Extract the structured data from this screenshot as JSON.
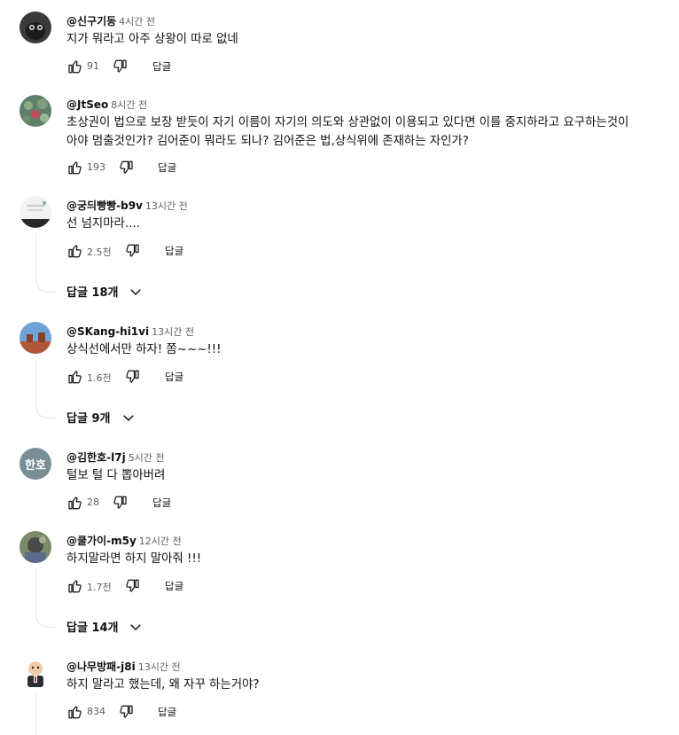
{
  "comments": [
    {
      "author": "@신구기동",
      "time": "4시간 전",
      "text": "지가 뭐라고 아주 상왕이 따로 없네",
      "text2": "",
      "likes": "91",
      "reply_label": "답글",
      "replies_toggle": ""
    },
    {
      "author": "@JtSeo",
      "time": "8시간 전",
      "text": "초상권이 법으로 보장 받듯이 자기 이름이 자기의 의도와 상관없이 이용되고 있다면 이를 중지하라고 요구하는것이",
      "text2": "아야 멈출것인가? 김어준이 뭐라도 되나? 김어준은 법,상식위에 존재하는 자인가?",
      "likes": "193",
      "reply_label": "답글",
      "replies_toggle": ""
    },
    {
      "author": "@궁듸빵빵-b9v",
      "time": "13시간 전",
      "text": "선 넘지마라....",
      "text2": "",
      "likes": "2.5천",
      "reply_label": "답글",
      "replies_toggle": "답글 18개"
    },
    {
      "author": "@SKang-hi1vi",
      "time": "13시간 전",
      "text": "상식선에서만 하자! 쫌~~~!!!",
      "text2": "",
      "likes": "1.6천",
      "reply_label": "답글",
      "replies_toggle": "답글 9개"
    },
    {
      "author": "@김한호-l7j",
      "time": "5시간 전",
      "text": "털보 털 다 뽑아버려",
      "text2": "",
      "likes": "28",
      "reply_label": "답글",
      "replies_toggle": "",
      "avatar_initials": "한호"
    },
    {
      "author": "@쿨가이-m5y",
      "time": "12시간 전",
      "text": "하지말라면 하지 말아줘 !!!",
      "text2": "",
      "likes": "1.7천",
      "reply_label": "답글",
      "replies_toggle": "답글 14개"
    },
    {
      "author": "@나무방패-j8i",
      "time": "13시간 전",
      "text": "하지 말라고 했는데, 왜 자꾸 하는거야?",
      "text2": "",
      "likes": "834",
      "reply_label": "답글",
      "replies_toggle": ""
    }
  ],
  "colors": {
    "text_primary": "#0f0f0f",
    "text_secondary": "#606060",
    "thread_line": "#e5e5e5",
    "initials_avatar": "#7a8e98"
  },
  "icons": [
    "like-icon",
    "dislike-icon",
    "chevron-down-icon"
  ]
}
